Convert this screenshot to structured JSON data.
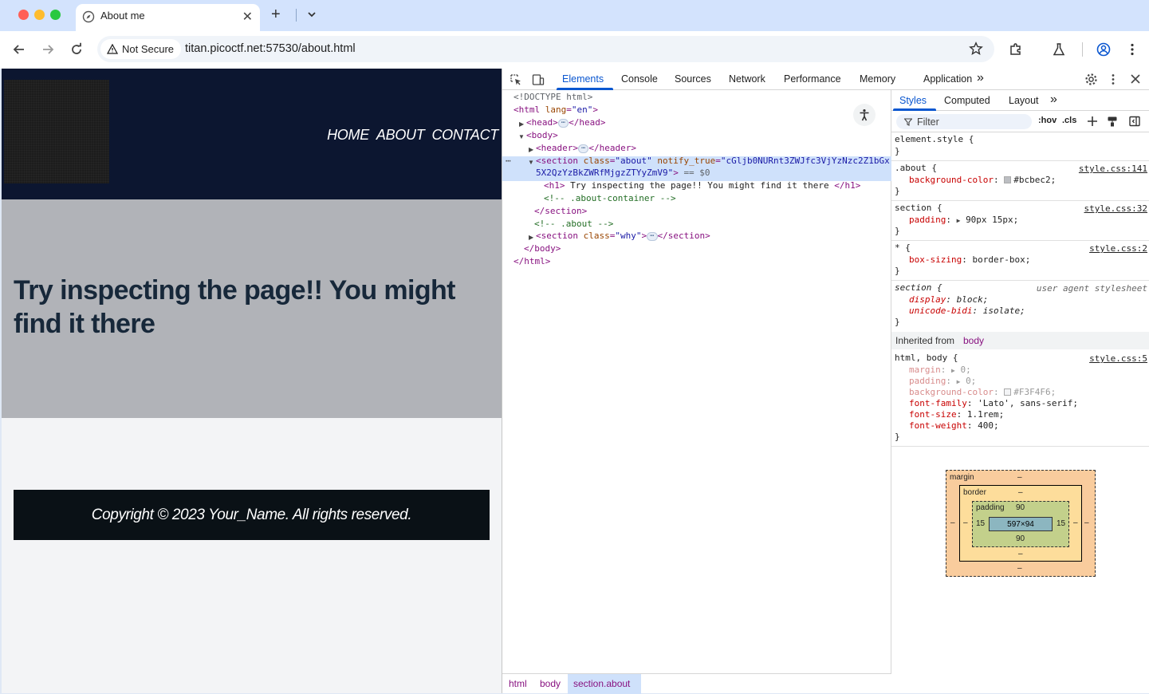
{
  "browser": {
    "tab_title": "About me",
    "tab_close": "✕",
    "new_tab": "+",
    "security_label": "Not Secure",
    "url": "titan.picoctf.net:57530/about.html"
  },
  "page": {
    "nav": [
      "HOME",
      "ABOUT",
      "CONTACT"
    ],
    "heading": "Try inspecting the page!! You might find it there",
    "footer": "Copyright © 2023 Your_Name. All rights reserved."
  },
  "devtools": {
    "tabs": [
      "Elements",
      "Console",
      "Sources",
      "Network",
      "Performance",
      "Memory",
      "Application"
    ],
    "more": "»",
    "dom": {
      "doctype": "<!DOCTYPE html>",
      "html_open_tag": "<html",
      "html_lang_attr": "lang",
      "html_lang_val": "\"en\"",
      "gt": ">",
      "head_open": "<head>",
      "head_close": "</head>",
      "body_open": "<body>",
      "header_open": "<header>",
      "header_close": "</header>",
      "section_open": "<section",
      "class_attr": "class",
      "about_val": "\"about\"",
      "notify_attr": "notify_true",
      "notify_val_1": "\"cGljb0NURnt3ZWJfc3VjYzNzc2Z1bGx",
      "notify_val_2": "5X2QzYzBkZWRfMjgzZTYyZmV9\"",
      "dollar": "== $0",
      "h1_open": "<h1>",
      "h1_text": " Try inspecting the page!! You might find it there ",
      "h1_close": "</h1>",
      "comment_container": "<!-- .about-container -->",
      "section_close": "</section>",
      "comment_about": "<!-- .about -->",
      "why_val": "\"why\"",
      "body_close": "</body>",
      "html_close": "</html>",
      "ellipsis": "⋯",
      "row_dots": "⋯"
    },
    "breadcrumbs": [
      "html",
      "body",
      "section.about"
    ],
    "styles": {
      "tabs": [
        "Styles",
        "Computed",
        "Layout"
      ],
      "filter": "Filter",
      "hov": ":hov",
      "cls": ".cls",
      "rules": {
        "element_style": "element.style {",
        "close": "}",
        "about_sel": ".about {",
        "about_src": "style.css:141",
        "bg_color": "background-color",
        "about_bg": "#bcbec2;",
        "about_swatch": "#bcbec2",
        "section_sel": "section {",
        "section_src": "style.css:32",
        "padding": "padding",
        "section_pad": "90px 15px;",
        "star_sel": "* {",
        "star_src": "style.css:2",
        "box_sizing": "box-sizing",
        "border_box": "border-box;",
        "ua_sel": "section {",
        "ua_src": "user agent stylesheet",
        "display": "display",
        "block": "block;",
        "unicode_bidi": "unicode-bidi",
        "isolate": "isolate;",
        "inherited_label": "Inherited from",
        "inherited_el": "body",
        "html_body_sel": "html, body {",
        "html_body_src": "style.css:5",
        "margin": "margin",
        "zero": "0;",
        "body_bg": "#F3F4F6;",
        "body_swatch": "#F3F4F6",
        "font_family": "font-family",
        "lato": "'Lato', sans-serif;",
        "font_size": "font-size",
        "rem": "1.1rem;",
        "font_weight": "font-weight",
        "w400": "400;",
        "colon": ":"
      },
      "box_model": {
        "margin_label": "margin",
        "border_label": "border",
        "padding_label": "padding",
        "dash": "–",
        "padding_top": "90",
        "padding_bottom": "90",
        "padding_left": "15",
        "padding_right": "15",
        "content": "597×94"
      }
    }
  },
  "colors": {
    "header_bg": "#0c1630",
    "about_bg": "#b1b3b8",
    "footer_bg": "#0a1116",
    "accent": "#0b57d0"
  }
}
